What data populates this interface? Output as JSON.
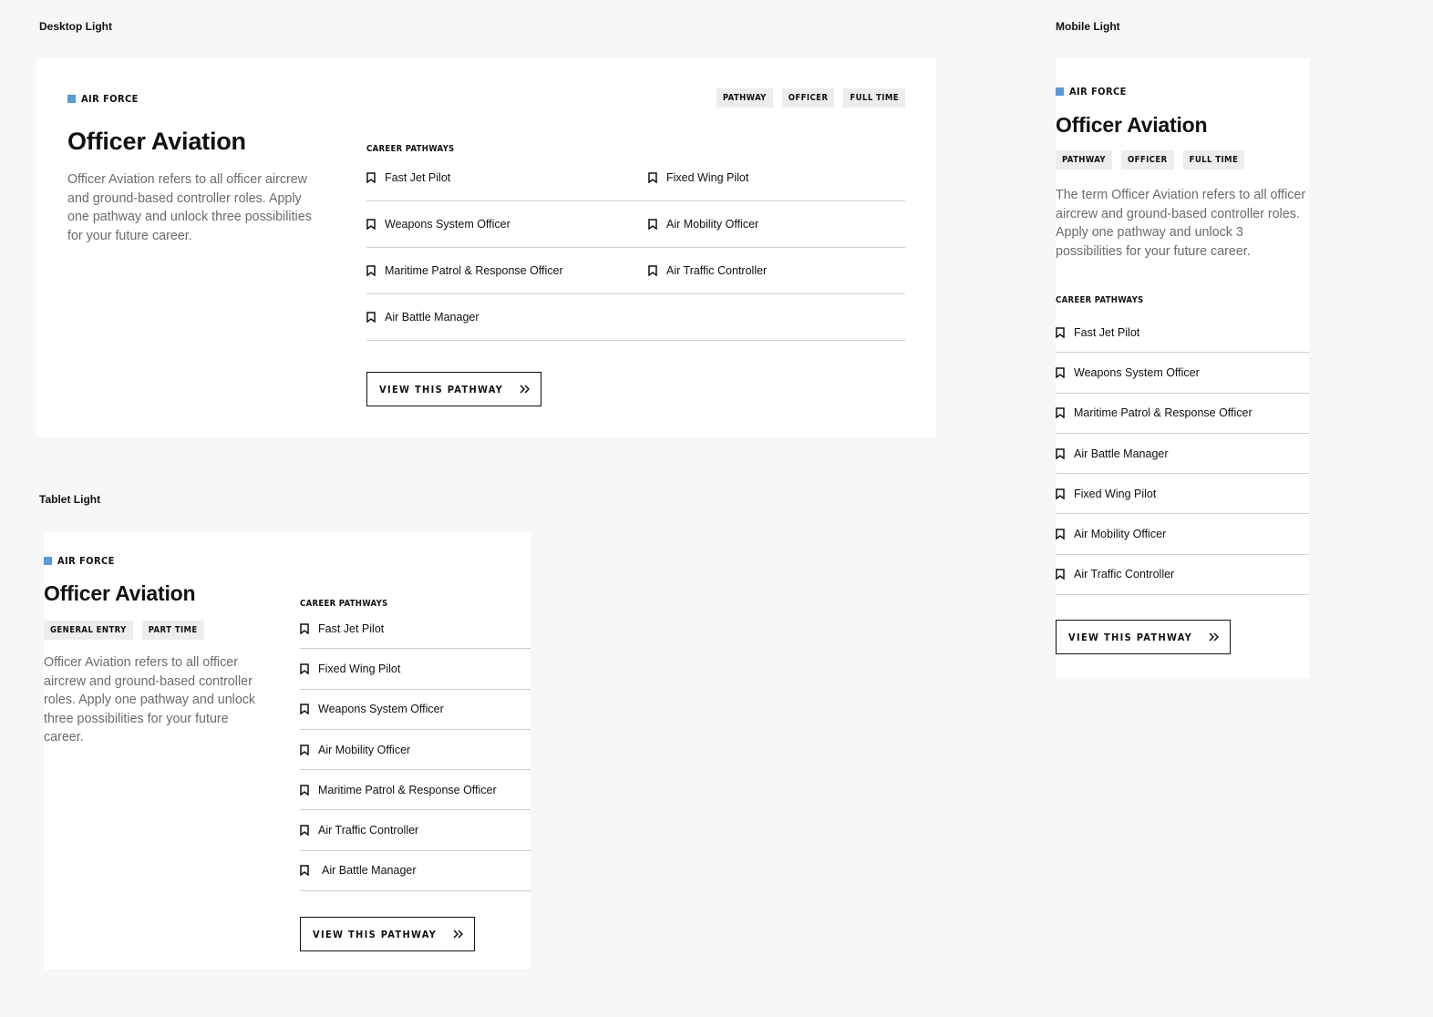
{
  "labels": {
    "desktop": "Desktop Light",
    "tablet": "Tablet Light",
    "mobile": "Mobile Light"
  },
  "colors": {
    "brand_square": "#5b9bd5",
    "background": "#f7f7f7",
    "card": "#ffffff"
  },
  "icons": {
    "pathway_item": "bookmark-icon",
    "button": "double-chevron-right-icon"
  },
  "desktop": {
    "brand": "AIR FORCE",
    "title": "Officer Aviation",
    "description": "Officer Aviation refers to all officer aircrew and ground-based controller roles. Apply one pathway and unlock three possibilities for your future career.",
    "tags": [
      "PATHWAY",
      "OFFICER",
      "FULL TIME"
    ],
    "section_label": "CAREER PATHWAYS",
    "pathways": [
      "Fast Jet Pilot",
      "Fixed Wing Pilot",
      "Weapons System Officer",
      "Air Mobility Officer",
      "Maritime Patrol & Response Officer",
      "Air Traffic Controller",
      "Air Battle Manager"
    ],
    "button": "VIEW THIS PATHWAY"
  },
  "tablet": {
    "brand": "AIR FORCE",
    "title": "Officer Aviation",
    "tags": [
      "GENERAL ENTRY",
      "PART TIME"
    ],
    "description": "Officer Aviation refers to all officer aircrew and ground-based controller roles. Apply one pathway and unlock three possibilities for your future career.",
    "section_label": "CAREER PATHWAYS",
    "pathways": [
      "Fast Jet Pilot",
      "Fixed Wing Pilot",
      "Weapons System Officer",
      "Air Mobility Officer",
      "Maritime Patrol & Response Officer",
      "Air Traffic Controller",
      "Air Battle Manager"
    ],
    "button": "VIEW THIS PATHWAY"
  },
  "mobile": {
    "brand": "AIR FORCE",
    "title": "Officer Aviation",
    "tags": [
      "PATHWAY",
      "OFFICER",
      "FULL TIME"
    ],
    "description": "The term Officer Aviation refers to all officer aircrew and ground-based controller roles. Apply one pathway and unlock 3 possibilities for your future career.",
    "section_label": "CAREER PATHWAYS",
    "pathways": [
      "Fast Jet Pilot",
      "Weapons System Officer",
      "Maritime Patrol & Response Officer",
      "Air Battle Manager",
      "Fixed Wing Pilot",
      "Air Mobility Officer",
      "Air Traffic Controller"
    ],
    "button": "VIEW THIS PATHWAY"
  }
}
